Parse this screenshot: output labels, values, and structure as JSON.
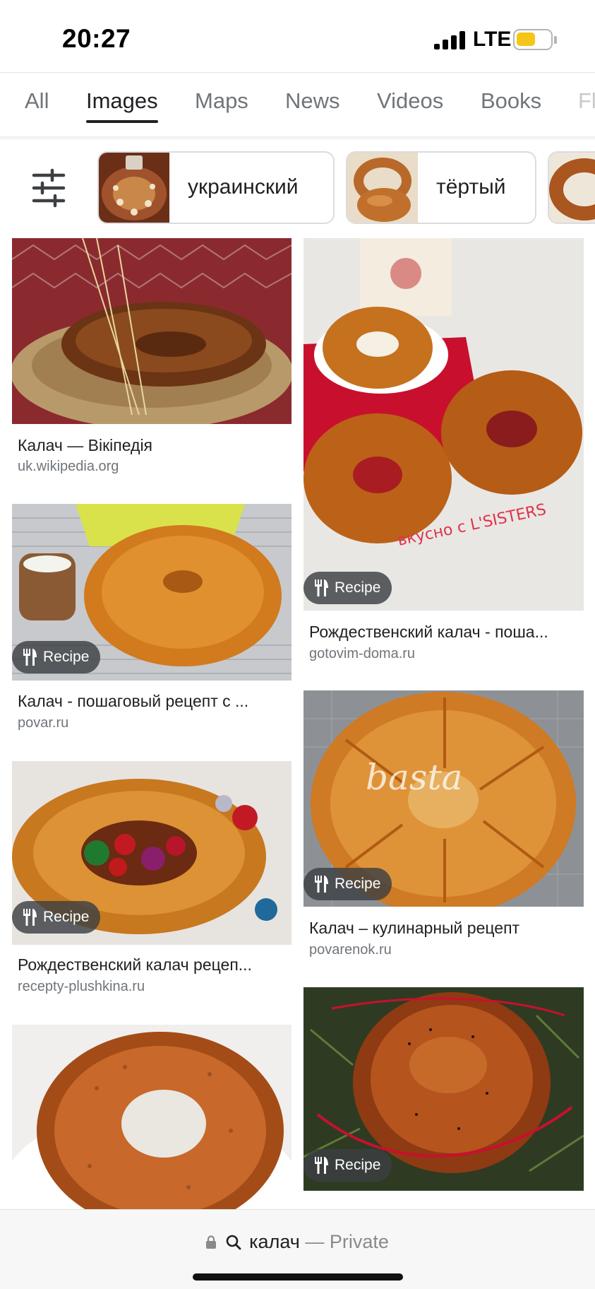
{
  "status_bar": {
    "time": "20:27",
    "network": "LTE"
  },
  "tabs": [
    {
      "label": "All",
      "active": false
    },
    {
      "label": "Images",
      "active": true
    },
    {
      "label": "Maps",
      "active": false
    },
    {
      "label": "News",
      "active": false
    },
    {
      "label": "Videos",
      "active": false
    },
    {
      "label": "Books",
      "active": false
    },
    {
      "label": "Fl",
      "active": false
    }
  ],
  "chips": [
    {
      "label": "украинский"
    },
    {
      "label": "тёртый"
    }
  ],
  "badge_label": "Recipe",
  "results": [
    {
      "title": "Калач — Вікіпедія",
      "source": "uk.wikipedia.org",
      "recipe": false
    },
    {
      "title": "Рождественский калач - поша...",
      "source": "gotovim-doma.ru",
      "recipe": true
    },
    {
      "title": "Калач - пошаговый рецепт с ...",
      "source": "povar.ru",
      "recipe": true
    },
    {
      "title": "Калач – кулинарный рецепт",
      "source": "povarenok.ru",
      "recipe": true
    },
    {
      "title": "Рождественский калач рецеп...",
      "source": "recepty-plushkina.ru",
      "recipe": true
    },
    {
      "title": "",
      "source": "",
      "recipe": false
    },
    {
      "title": "",
      "source": "",
      "recipe": true
    }
  ],
  "watermarks": {
    "basta": "basta",
    "lsisters": "вкусно с L'SISTERS"
  },
  "address_bar": {
    "query": "калач",
    "separator": "—",
    "mode": "Private"
  },
  "colors": {
    "active_tab": "#202124",
    "inactive_tab": "#70757a",
    "badge_bg": "#3c4043",
    "battery": "#f5c518"
  }
}
